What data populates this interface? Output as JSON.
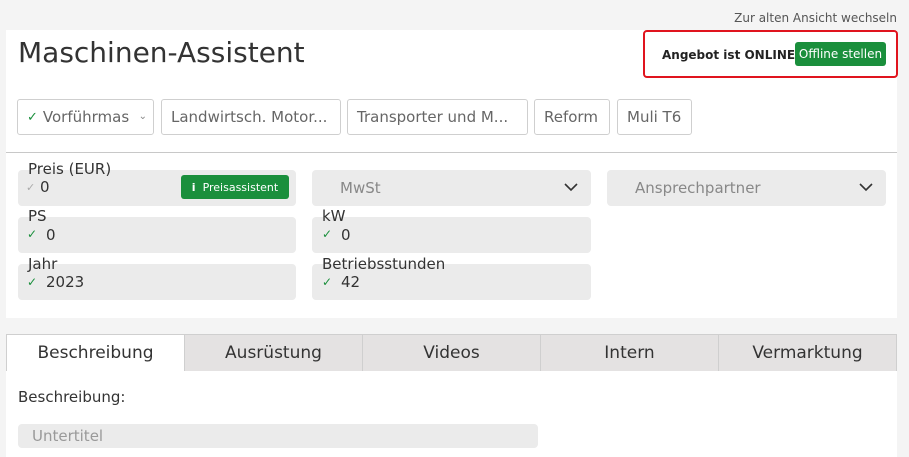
{
  "header": {
    "old_view_link": "Zur alten Ansicht wechseln",
    "title": "Maschinen-Assistent",
    "status_text": "Angebot ist ONLINE",
    "offline_button": "Offline stellen"
  },
  "categories": [
    {
      "label": "Vorführmas",
      "selected": true
    },
    {
      "label": "Landwirtsch. Motor..."
    },
    {
      "label": "Transporter und M..."
    },
    {
      "label": "Reform"
    },
    {
      "label": "Muli T6"
    }
  ],
  "fields": {
    "preis": {
      "label": "Preis (EUR)",
      "value": "0",
      "button": "Preisassistent"
    },
    "mwst": {
      "placeholder": "MwSt"
    },
    "ansprechpartner": {
      "placeholder": "Ansprechpartner"
    },
    "ps": {
      "label": "PS",
      "value": "0"
    },
    "kw": {
      "label": "kW",
      "value": "0"
    },
    "jahr": {
      "label": "Jahr",
      "value": "2023"
    },
    "betriebsstunden": {
      "label": "Betriebsstunden",
      "value": "42"
    }
  },
  "tabs": [
    {
      "label": "Beschreibung",
      "active": true
    },
    {
      "label": "Ausrüstung"
    },
    {
      "label": "Videos"
    },
    {
      "label": "Intern"
    },
    {
      "label": "Vermarktung"
    }
  ],
  "description": {
    "label": "Beschreibung:",
    "subtitle_placeholder": "Untertitel"
  },
  "colors": {
    "accent_green": "#1a8f3c",
    "status_border_red": "#e0141e",
    "field_bg": "#ebebeb",
    "page_bg": "#f4f4f4"
  },
  "icons": {
    "check": "check-icon",
    "chevron": "chevron-down-icon",
    "info": "info-icon"
  }
}
